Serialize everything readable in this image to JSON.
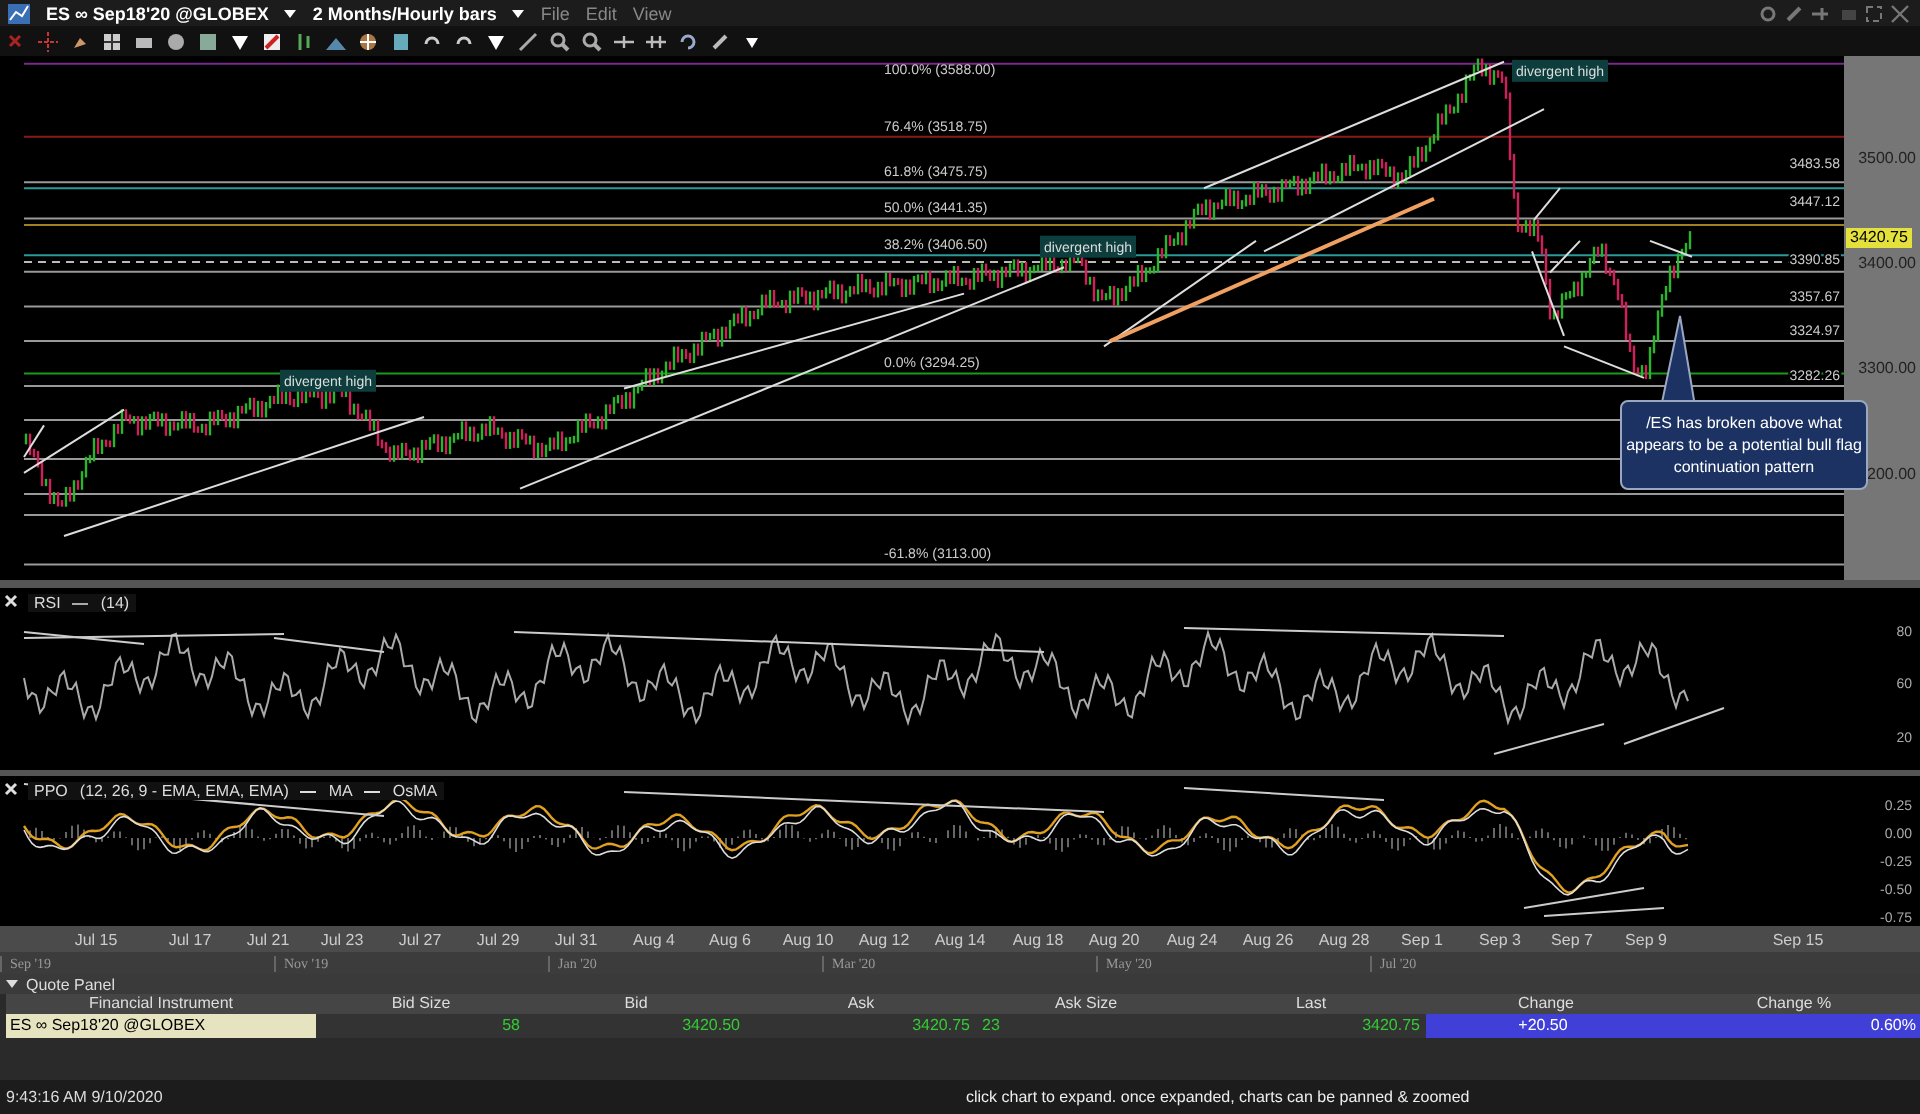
{
  "window": {
    "symbol": "ES ∞ Sep18'20 @GLOBEX",
    "timeframe": "2 Months/Hourly bars",
    "menus": [
      "File",
      "Edit",
      "View"
    ]
  },
  "price_chart": {
    "fib_levels": [
      "100.0% (3588.00)",
      "76.4% (3518.75)",
      "61.8% (3475.75)",
      "50.0% (3441.35)",
      "38.2% (3406.50)",
      "0.0% (3294.25)",
      "-61.8% (3113.00)"
    ],
    "levels": [
      "3483.58",
      "3447.12",
      "3390.85",
      "3357.67",
      "3324.97",
      "3282.26"
    ],
    "axis": [
      "3500.00",
      "3400.00",
      "3300.00",
      "200.00"
    ],
    "last_price": "3420.75",
    "annotations": [
      "divergent high",
      "divergent high",
      "divergent high"
    ],
    "callout": "/ES has broken above what appears to be a potential bull flag continuation pattern"
  },
  "rsi": {
    "name": "RSI",
    "params": "(14)",
    "axis": [
      "80",
      "60",
      "20"
    ]
  },
  "ppo": {
    "name": "PPO",
    "params": "(12, 26, 9 - EMA, EMA, EMA)",
    "legend": [
      "MA",
      "OsMA"
    ],
    "axis": [
      "0.25",
      "0.00",
      "-0.25",
      "-0.50",
      "-0.75"
    ]
  },
  "date_axis": [
    "Jul 15",
    "Jul 17",
    "Jul 21",
    "Jul 23",
    "Jul 27",
    "Jul 29",
    "Jul 31",
    "Aug 4",
    "Aug 6",
    "Aug 10",
    "Aug 12",
    "Aug 14",
    "Aug 18",
    "Aug 20",
    "Aug 24",
    "Aug 26",
    "Aug 28",
    "Sep 1",
    "Sep 3",
    "Sep 7",
    "Sep 9",
    "Sep 15"
  ],
  "navigator": [
    "Sep '19",
    "Nov '19",
    "Jan '20",
    "Mar '20",
    "May '20",
    "Jul '20"
  ],
  "quote_panel": {
    "title": "Quote Panel",
    "columns": [
      "Financial Instrument",
      "Bid Size",
      "Bid",
      "Ask",
      "Ask Size",
      "Last",
      "Change",
      "Change %"
    ],
    "row": [
      "ES ∞ Sep18'20 @GLOBEX",
      "58",
      "3420.50",
      "3420.75",
      "23",
      "3420.75",
      "+20.50",
      "0.60%"
    ]
  },
  "status_bar": {
    "time": "9:43:16 AM 9/10/2020",
    "message": "click chart to expand. once expanded, charts can be panned & zoomed"
  }
}
